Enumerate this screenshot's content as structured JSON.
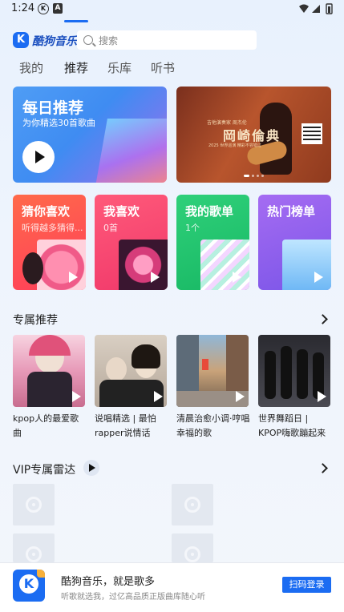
{
  "status_bar": {
    "time": "1:24",
    "icon_k": "K",
    "icon_a": "A"
  },
  "header": {
    "logo_letter": "K",
    "logo_text": "酷狗音乐",
    "search_placeholder": "搜索"
  },
  "tabs": [
    {
      "label": "我的",
      "active": false
    },
    {
      "label": "推荐",
      "active": true
    },
    {
      "label": "乐库",
      "active": false
    },
    {
      "label": "听书",
      "active": false
    }
  ],
  "daily": {
    "title": "每日推荐",
    "subtitle": "为你精选30首歌曲"
  },
  "banner": {
    "small_top": "吉他演奏家 周杰伦",
    "title": "岡崎倫典",
    "small_bottom": "2025 世界巡演 精彩不容错过"
  },
  "mini_cards": [
    {
      "title": "猜你喜欢",
      "subtitle": "听得越多猜得..."
    },
    {
      "title": "我喜欢",
      "subtitle": "0首"
    },
    {
      "title": "我的歌单",
      "subtitle": "1个"
    },
    {
      "title": "热门榜单",
      "subtitle": ""
    }
  ],
  "section_exclusive": {
    "title": "专属推荐"
  },
  "playlists": [
    {
      "name": "kpop人的最爱歌曲"
    },
    {
      "name": "说唱精选 | 最怕rapper说情话"
    },
    {
      "name": "清晨治愈小调·哼唱幸福的歌"
    },
    {
      "name": "世界舞蹈日 | KPOP嗨歌蹦起来"
    }
  ],
  "section_vip": {
    "title": "VIP专属雷达"
  },
  "promo": {
    "logo_letter": "K",
    "title": "酷狗音乐，就是歌多",
    "subtitle": "听歌就选我，过亿高品质正版曲库随心听",
    "button": "扫码登录"
  }
}
